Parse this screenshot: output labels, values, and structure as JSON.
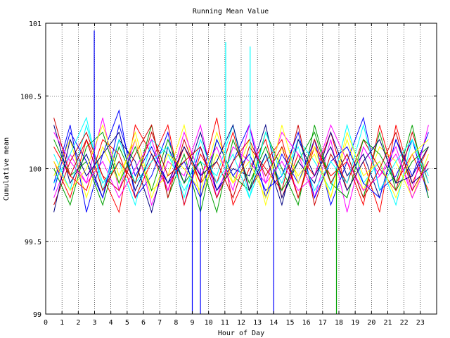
{
  "chart_data": {
    "type": "line",
    "title": "Running Mean Value",
    "xlabel": "Hour of Day",
    "ylabel": "Cumulative mean",
    "xlim": [
      0,
      24
    ],
    "ylim": [
      99,
      101
    ],
    "x_ticks": [
      0,
      1,
      2,
      3,
      4,
      5,
      6,
      7,
      8,
      9,
      10,
      11,
      12,
      13,
      14,
      15,
      16,
      17,
      18,
      19,
      20,
      21,
      22,
      23
    ],
    "x_tick_labels": [
      "0",
      "1",
      "2",
      "3",
      "4",
      "5",
      "6",
      "7",
      "8",
      "9",
      "10",
      "11",
      "12",
      "13",
      "14",
      "15",
      "16",
      "17",
      "18",
      "19",
      "20",
      "21",
      "22",
      "23"
    ],
    "y_ticks": [
      99,
      99.5,
      100,
      100.5,
      101
    ],
    "y_tick_labels": [
      "99",
      "99.5",
      "100",
      "100.5",
      "101"
    ],
    "grid": true,
    "legend": "none",
    "series_colors": [
      "#ff0000",
      "#0000ff",
      "#00a000",
      "#ff00ff",
      "#00ffff",
      "#ffff00",
      "#000080",
      "#cc0000"
    ],
    "series": [
      {
        "values": [
          100.05,
          99.8,
          100.2,
          99.95,
          99.7,
          100.3,
          100.1,
          99.85,
          100.15,
          99.9,
          100.35,
          99.75,
          100,
          100.2,
          99.8,
          100.1,
          99.95,
          100.25,
          99.85,
          100.05,
          99.7,
          100.3,
          99.9,
          100.15
        ]
      },
      {
        "values": [
          99.9,
          100.3,
          99.7,
          100.1,
          100.4,
          99.8,
          99.95,
          100.25,
          99.75,
          100.15,
          99.85,
          100.05,
          100.3,
          99.8,
          100.1,
          99.9,
          100.2,
          99.75,
          100.05,
          100.35,
          99.85,
          99.95,
          100.2,
          99.8
        ]
      },
      {
        "values": [
          100.2,
          99.95,
          100.05,
          99.75,
          100.15,
          99.9,
          100.3,
          99.8,
          100.1,
          99.7,
          100.2,
          99.95,
          99.85,
          100.25,
          100,
          99.75,
          100.3,
          99.9,
          100.1,
          99.8,
          100.25,
          99.85,
          100.05,
          100.15
        ]
      },
      {
        "values": [
          99.8,
          100.1,
          99.9,
          100.35,
          99.85,
          100.2,
          99.75,
          100.05,
          99.95,
          100.3,
          99.8,
          100.15,
          100.05,
          99.9,
          100.25,
          100.1,
          99.8,
          100.2,
          99.7,
          100.15,
          99.95,
          100.1,
          99.85,
          100.3
        ]
      },
      {
        "values": [
          100.1,
          99.85,
          100.3,
          99.9,
          100.05,
          99.75,
          100.2,
          100.1,
          99.85,
          100.05,
          99.95,
          100.3,
          99.8,
          100.1,
          99.9,
          100.2,
          100.05,
          99.85,
          100.3,
          99.9,
          100.05,
          99.75,
          100.2,
          99.95
        ]
      },
      {
        "values": [
          99.95,
          100.2,
          99.8,
          100.15,
          99.9,
          100.25,
          99.85,
          99.95,
          100.3,
          99.8,
          100.1,
          99.9,
          100.2,
          99.75,
          100.15,
          99.95,
          100.1,
          99.8,
          100.2,
          99.85,
          100.15,
          100.05,
          99.8,
          100.1
        ]
      },
      {
        "values": [
          100.3,
          99.9,
          100.1,
          99.8,
          100.2,
          100.05,
          99.7,
          100.15,
          99.9,
          100.25,
          99.85,
          100,
          99.95,
          100.3,
          99.8,
          100.05,
          99.9,
          100.25,
          99.95,
          100.1,
          99.8,
          100.2,
          99.9,
          100
        ]
      },
      {
        "values": [
          99.75,
          100.05,
          100.25,
          99.95,
          99.85,
          100.1,
          100.3,
          99.8,
          100.2,
          99.9,
          100.05,
          99.8,
          100.15,
          100,
          99.85,
          100.3,
          99.75,
          100.1,
          99.9,
          100.2,
          100,
          99.85,
          100.25,
          99.9
        ]
      },
      {
        "values": [
          100.15,
          99.95,
          99.85,
          100.2,
          100.1,
          99.8,
          100.05,
          100.3,
          99.75,
          100.1,
          99.9,
          100.25,
          99.85,
          100.05,
          100.2,
          99.8,
          100.15,
          99.95,
          100.05,
          99.75,
          100.3,
          99.9,
          100.1,
          99.85
        ]
      },
      {
        "values": [
          99.85,
          100.25,
          100.05,
          99.8,
          100.3,
          99.95,
          100.15,
          99.9,
          100.05,
          99.8,
          100.2,
          99.95,
          100.1,
          99.85,
          99.95,
          100.25,
          99.8,
          100.05,
          100.15,
          99.9,
          99.8,
          100.2,
          99.95,
          100.25
        ]
      },
      {
        "values": [
          100,
          99.75,
          100.15,
          100.25,
          99.9,
          100.15,
          99.85,
          100.2,
          99.9,
          100.05,
          99.7,
          100.2,
          99.9,
          100.15,
          99.85,
          100.05,
          100.25,
          99.9,
          99.8,
          100.2,
          100.1,
          99.9,
          100.3,
          99.8
        ]
      },
      {
        "values": [
          100.25,
          100.05,
          99.9,
          100.05,
          99.8,
          100,
          100.2,
          99.85,
          100.25,
          99.95,
          100.15,
          99.85,
          100.3,
          99.9,
          100.05,
          99.85,
          99.95,
          100.3,
          100.05,
          99.85,
          99.95,
          100.15,
          99.8,
          100.05
        ]
      },
      {
        "values": [
          99.9,
          100.1,
          100.35,
          99.85,
          100.2,
          99.9,
          100.05,
          100.15,
          99.8,
          100.2,
          99.9,
          100.1,
          99.8,
          100.25,
          99.95,
          100.15,
          99.85,
          100.05,
          99.9,
          100.3,
          99.85,
          100.05,
          100.2,
          99.9
        ]
      },
      {
        "values": [
          100.05,
          99.85,
          100,
          100.3,
          99.95,
          100.2,
          99.8,
          100.1,
          100,
          99.85,
          100.25,
          99.9,
          100.05,
          99.8,
          100.3,
          99.9,
          100.15,
          99.8,
          100.25,
          99.95,
          100.05,
          99.8,
          100.1,
          100.2
        ]
      },
      {
        "values": [
          99.7,
          100.2,
          99.95,
          100.1,
          100.25,
          99.85,
          100.1,
          99.9,
          100.15,
          99.95,
          100.05,
          100.3,
          99.85,
          100.1,
          99.75,
          100.2,
          99.95,
          100.15,
          99.85,
          100.05,
          100.2,
          99.9,
          99.95,
          100.15
        ]
      },
      {
        "values": [
          100.35,
          99.95,
          100.2,
          99.85,
          100.05,
          99.9,
          100.25,
          99.95,
          100.05,
          100.15,
          99.8,
          100.05,
          100.2,
          99.95,
          100.15,
          99.8,
          100.2,
          99.9,
          100.1,
          99.8,
          100,
          100.25,
          99.85,
          100.05
        ]
      }
    ],
    "spikes": [
      {
        "x": 2.98,
        "y": 100.95
      },
      {
        "x": 9.0,
        "y": 99.0
      },
      {
        "x": 9.5,
        "y": 99.0
      },
      {
        "x": 11.05,
        "y": 100.87
      },
      {
        "x": 12.55,
        "y": 100.84
      },
      {
        "x": 14.0,
        "y": 99.0
      },
      {
        "x": 17.85,
        "y": 99.0
      }
    ],
    "spike_colors": [
      "#0000ff",
      "#0000ff",
      "#0000ff",
      "#00ffff",
      "#00ffff",
      "#0000ff",
      "#00a000"
    ]
  }
}
